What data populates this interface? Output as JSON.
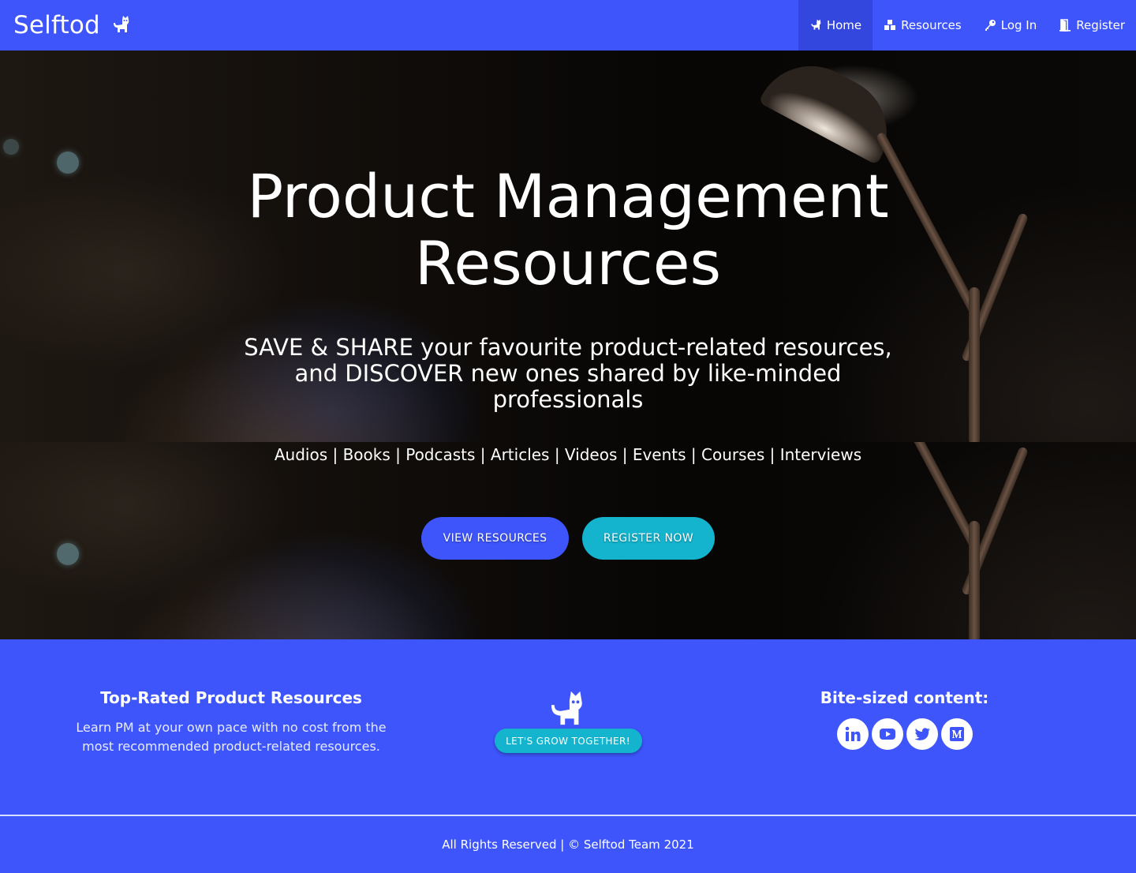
{
  "navbar": {
    "brand": "Selftod",
    "brand_icon": "cat-icon",
    "items": [
      {
        "label": "Home",
        "icon": "cat-icon",
        "active": true
      },
      {
        "label": "Resources",
        "icon": "boxes-icon",
        "active": false
      },
      {
        "label": "Log In",
        "icon": "key-icon",
        "active": false
      },
      {
        "label": "Register",
        "icon": "door-icon",
        "active": false
      }
    ]
  },
  "hero": {
    "title_line1": "Product Management",
    "title_line2": "Resources",
    "subtitle": "SAVE & SHARE your favourite product-related resources, and DISCOVER new ones shared by like-minded professionals",
    "resource_types": "Audios | Books | Podcasts | Articles | Videos | Events | Courses | Interviews",
    "view_button": "VIEW RESOURCES",
    "register_button": "REGISTER NOW"
  },
  "features": {
    "left_title": "Top-Rated Product Resources",
    "left_text": "Learn PM at your own pace with no cost from the most recommended product-related resources.",
    "mid_icon": "cat-icon",
    "grow_button": "LET'S GROW TOGETHER!",
    "right_title": "Bite-sized content:",
    "socials": [
      "linkedin-icon",
      "youtube-icon",
      "twitter-icon",
      "medium-icon"
    ]
  },
  "footer": {
    "text": "All Rights Reserved | © Selftod Team 2021"
  },
  "colors": {
    "primary": "#3d55fb",
    "accent": "#14b4cf",
    "active_nav": "#3346dd"
  }
}
